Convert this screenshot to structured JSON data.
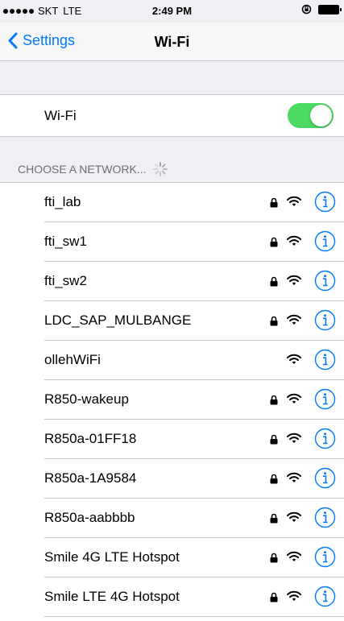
{
  "status_bar": {
    "carrier": "SKT",
    "network": "LTE",
    "time": "2:49 PM"
  },
  "nav": {
    "back_label": "Settings",
    "title": "Wi-Fi"
  },
  "wifi_toggle": {
    "label": "Wi-Fi",
    "on": true,
    "color": "#4cd964"
  },
  "section": {
    "header": "CHOOSE A NETWORK..."
  },
  "networks": [
    {
      "name": "fti_lab",
      "secured": true
    },
    {
      "name": "fti_sw1",
      "secured": true
    },
    {
      "name": "fti_sw2",
      "secured": true
    },
    {
      "name": "LDC_SAP_MULBANGE",
      "secured": true
    },
    {
      "name": "ollehWiFi",
      "secured": false
    },
    {
      "name": "R850-wakeup",
      "secured": true
    },
    {
      "name": "R850a-01FF18",
      "secured": true
    },
    {
      "name": "R850a-1A9584",
      "secured": true
    },
    {
      "name": "R850a-aabbbb",
      "secured": true
    },
    {
      "name": "Smile 4G LTE Hotspot",
      "secured": true
    },
    {
      "name": "Smile LTE 4G Hotspot",
      "secured": true
    }
  ],
  "colors": {
    "accent": "#007aff",
    "background": "#efeff4",
    "separator": "#c8c7cc"
  },
  "icons": {
    "lock": "lock-icon",
    "wifi": "wifi-signal-icon",
    "info": "info-icon",
    "back": "chevron-left-icon"
  }
}
